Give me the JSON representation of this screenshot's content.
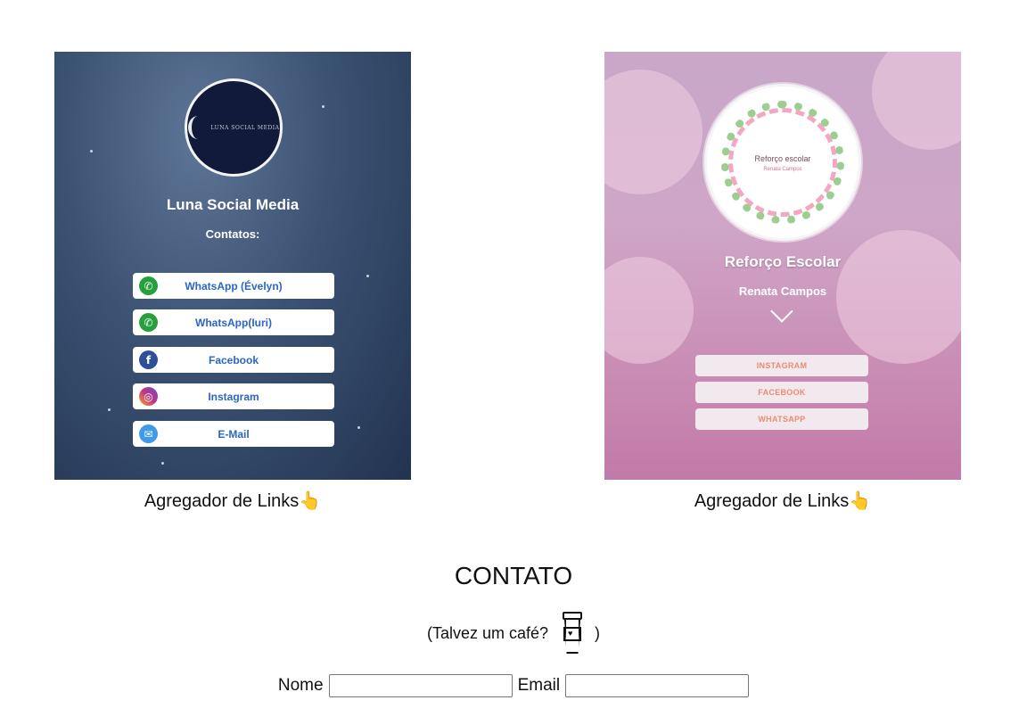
{
  "luna_card": {
    "logo_text": "LUNA SOCIAL MEDIA",
    "title": "Luna Social Media",
    "subtitle": "Contatos:",
    "links": [
      {
        "label": "WhatsApp (Évelyn)",
        "icon": "whatsapp-icon",
        "color": "#25a03d"
      },
      {
        "label": "WhatsApp(Iuri)",
        "icon": "whatsapp-icon",
        "color": "#25a03d"
      },
      {
        "label": "Facebook",
        "icon": "facebook-icon",
        "color": "#2f4f9a"
      },
      {
        "label": "Instagram",
        "icon": "instagram-icon",
        "color": "#c13584"
      },
      {
        "label": "E-Mail",
        "icon": "email-icon",
        "color": "#3d9be9"
      }
    ]
  },
  "reforco_card": {
    "logo_title": "Reforço escolar",
    "logo_subtitle": "Renata Campos",
    "title": "Reforço Escolar",
    "subtitle": "Renata Campos",
    "buttons": [
      "INSTAGRAM",
      "FACEBOOK",
      "WHATSAPP"
    ]
  },
  "captions": [
    "Agregador de Links👆",
    "Agregador de Links👆"
  ],
  "contact": {
    "heading": "CONTATO",
    "coffee_prefix": "(Talvez um café?",
    "coffee_suffix": ")",
    "name_label": "Nome",
    "email_label": "Email",
    "name_value": "",
    "email_value": ""
  }
}
